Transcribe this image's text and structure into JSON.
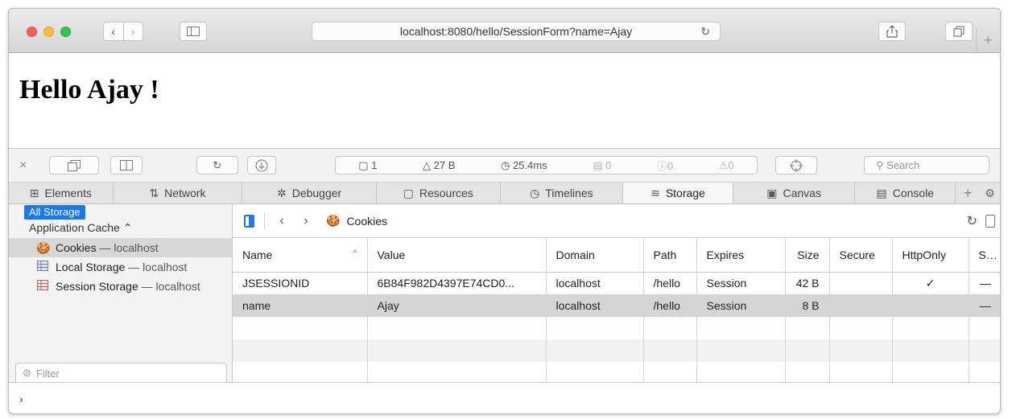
{
  "browser": {
    "url": "localhost:8080/hello/SessionForm?name=Ajay",
    "back_glyph": "‹",
    "forward_glyph": "›",
    "new_tab_glyph": "+"
  },
  "page": {
    "heading": "Hello Ajay !"
  },
  "inspector_toolbar": {
    "close_glyph": "×",
    "resources_count": "1",
    "resources_size": "27 B",
    "load_time": "25.4ms",
    "logs_count": "0",
    "errors_count": "0",
    "warnings_count": "0",
    "search_placeholder": "Search"
  },
  "tabs": [
    {
      "label": "Elements",
      "icon": "elements-icon",
      "glyph": "⊞"
    },
    {
      "label": "Network",
      "icon": "network-icon",
      "glyph": "⇅"
    },
    {
      "label": "Debugger",
      "icon": "debugger-icon",
      "glyph": "✲"
    },
    {
      "label": "Resources",
      "icon": "resources-icon",
      "glyph": "▢"
    },
    {
      "label": "Timelines",
      "icon": "timelines-icon",
      "glyph": "◷"
    },
    {
      "label": "Storage",
      "icon": "storage-icon",
      "glyph": "≋"
    },
    {
      "label": "Canvas",
      "icon": "canvas-icon",
      "glyph": "▣"
    },
    {
      "label": "Console",
      "icon": "console-icon",
      "glyph": "▤"
    }
  ],
  "sidebar": {
    "all_storage": "All Storage",
    "app_cache": "Application Cache",
    "items": [
      {
        "label": "Cookies",
        "host": "— localhost",
        "icon": "cookie-icon"
      },
      {
        "label": "Local Storage",
        "host": "— localhost",
        "icon": "local-storage-icon"
      },
      {
        "label": "Session Storage",
        "host": "— localhost",
        "icon": "session-storage-icon"
      }
    ],
    "filter_placeholder": "Filter"
  },
  "storage_panel": {
    "crumb": "Cookies"
  },
  "cookies_table": {
    "columns": [
      "Name",
      "Value",
      "Domain",
      "Path",
      "Expires",
      "Size",
      "Secure",
      "HttpOnly",
      "S..."
    ],
    "rows": [
      {
        "name": "JSESSIONID",
        "value": "6B84F982D4397E74CD0...",
        "domain": "localhost",
        "path": "/hello",
        "expires": "Session",
        "size": "42 B",
        "secure": "",
        "httponly": "✓",
        "samesite": "—"
      },
      {
        "name": "name",
        "value": "Ajay",
        "domain": "localhost",
        "path": "/hello",
        "expires": "Session",
        "size": "8 B",
        "secure": "",
        "httponly": "",
        "samesite": "—"
      }
    ]
  },
  "console": {
    "prompt": "›"
  }
}
